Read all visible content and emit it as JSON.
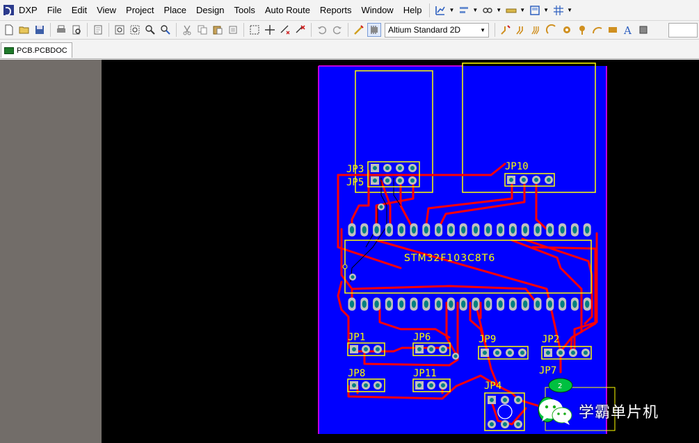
{
  "app": {
    "logo_label": "DXP",
    "menu": [
      {
        "label": "DXP",
        "accel": "X"
      },
      {
        "label": "File",
        "accel": "F"
      },
      {
        "label": "Edit",
        "accel": "E"
      },
      {
        "label": "View",
        "accel": "V"
      },
      {
        "label": "Project",
        "accel": "C"
      },
      {
        "label": "Place",
        "accel": "P"
      },
      {
        "label": "Design",
        "accel": "D"
      },
      {
        "label": "Tools",
        "accel": "T"
      },
      {
        "label": "Auto Route",
        "accel": "A"
      },
      {
        "label": "Reports",
        "accel": "R"
      },
      {
        "label": "Window",
        "accel": "W"
      },
      {
        "label": "Help",
        "accel": "H"
      }
    ]
  },
  "toolbar": {
    "view_mode": "Altium Standard 2D",
    "buttons": [
      "new-icon",
      "open-icon",
      "save-icon",
      "print-icon",
      "print-preview-icon",
      "document-icon",
      "zoom-fit-icon",
      "zoom-area-icon",
      "zoom-selected-icon",
      "zoom-filter-icon",
      "cut-icon",
      "copy-icon",
      "paste-icon",
      "rubber-stamp-icon",
      "select-area-icon",
      "move-icon",
      "deselect-icon",
      "clear-filter-icon",
      "undo-icon",
      "redo-icon",
      "cross-probe-icon",
      "browse-component-icon"
    ],
    "place_buttons": [
      "interactive-route-icon",
      "diff-pair-route-icon",
      "multi-route-icon",
      "arc-icon",
      "pad-icon",
      "via-icon",
      "arc-edge-icon",
      "fill-icon",
      "string-icon",
      "component-icon"
    ]
  },
  "tabs": [
    {
      "label": "PCB.PCBDOC",
      "active": true
    }
  ],
  "pcb": {
    "ic_label": "STM32F103C8T6",
    "designators": [
      "JP3",
      "JP5",
      "JP10",
      "JP1",
      "JP6",
      "JP9",
      "JP2",
      "JP7",
      "JP8",
      "JP11",
      "JP4"
    ],
    "pad_label_jp7": "2",
    "colors": {
      "board": "#0000ff",
      "track": "#ff0000",
      "silkscreen": "#ffff00",
      "pad": "#c0c0c0",
      "pad_hole": "#008080",
      "outline": "#ff00ff",
      "canvas": "#000000"
    }
  },
  "watermark": {
    "text": "学霸单片机",
    "icon": "wechat-icon"
  }
}
